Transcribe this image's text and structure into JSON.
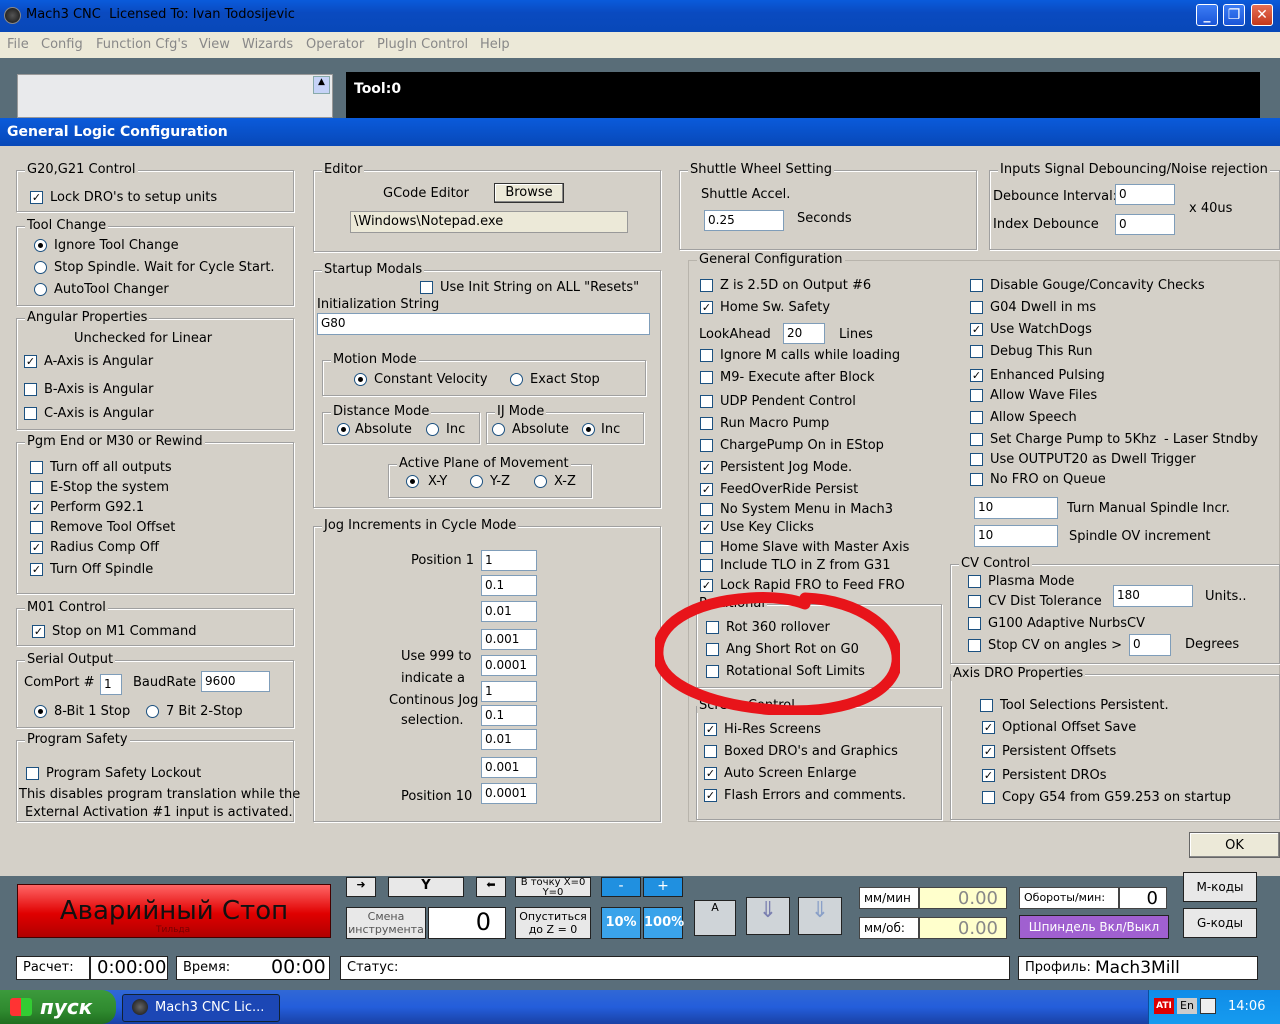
{
  "window": {
    "title": "Mach3 CNC  Licensed To: Ivan Todosijevic",
    "min": "_",
    "max": "❐",
    "close": "✕"
  },
  "menu": [
    "File",
    "Config",
    "Function Cfg's",
    "View",
    "Wizards",
    "Operator",
    "PlugIn Control",
    "Help"
  ],
  "tool_display": "Tool:0",
  "dialog": {
    "title": "General Logic Configuration",
    "g20g21": {
      "title": "G20,G21 Control",
      "lock_dro": {
        "label": "Lock DRO's to setup units",
        "checked": true
      }
    },
    "tool_change": {
      "title": "Tool Change",
      "options": [
        "Ignore Tool Change",
        "Stop Spindle. Wait for Cycle Start.",
        "AutoTool Changer"
      ],
      "selected": 0
    },
    "angular": {
      "title": "Angular Properties",
      "note": "Unchecked for Linear",
      "a": "A-Axis is Angular",
      "b": "B-Axis is Angular",
      "c": "C-Axis is Angular"
    },
    "pgm_end": {
      "title": "Pgm End or M30 or Rewind",
      "items": [
        "Turn off all outputs",
        "E-Stop the system",
        "Perform G92.1",
        "Remove Tool Offset",
        "Radius Comp Off",
        "Turn Off Spindle"
      ]
    },
    "m01": {
      "title": "M01 Control",
      "label": "Stop on M1 Command"
    },
    "serial": {
      "title": "Serial Output",
      "comport_label": "ComPort #",
      "comport": "1",
      "baud_label": "BaudRate",
      "baud": "9600",
      "bit8": "8-Bit 1 Stop",
      "bit7": "7 Bit 2-Stop"
    },
    "safety": {
      "title": "Program Safety",
      "label": "Program Safety Lockout",
      "note1": "This disables program translation while the",
      "note2": "External Activation #1 input is activated."
    },
    "editor": {
      "title": "Editor",
      "label": "GCode Editor",
      "browse": "Browse",
      "path": "\\Windows\\Notepad.exe"
    },
    "startup": {
      "title": "Startup Modals",
      "use_init": "Use Init String on ALL  \"Resets\"",
      "init_label": "Initialization String",
      "init_value": "G80"
    },
    "motion": {
      "title": "Motion Mode",
      "cv": "Constant Velocity",
      "es": "Exact Stop"
    },
    "distance": {
      "title": "Distance Mode",
      "abs": "Absolute",
      "inc": "Inc"
    },
    "ij": {
      "title": "IJ Mode",
      "abs": "Absolute",
      "inc": "Inc"
    },
    "plane": {
      "title": "Active Plane of Movement",
      "xy": "X-Y",
      "yz": "Y-Z",
      "xz": "X-Z"
    },
    "jog": {
      "title": "Jog Increments in Cycle Mode",
      "pos1": "Position 1",
      "pos10": "Position 10",
      "note": [
        "Use 999 to",
        "indicate a",
        "Continous Jog",
        "selection."
      ],
      "values": [
        "1",
        "0.1",
        "0.01",
        "0.001",
        "0.0001",
        "1",
        "0.1",
        "0.01",
        "0.001",
        "0.0001"
      ]
    },
    "shuttle": {
      "title": "Shuttle Wheel Setting",
      "label": "Shuttle Accel.",
      "value": "0.25",
      "unit": "Seconds"
    },
    "debounce": {
      "title": "Inputs Signal Debouncing/Noise rejection",
      "interval_label": "Debounce Interval:",
      "interval": "0",
      "index_label": "Index Debounce",
      "index": "0",
      "unit": "x 40us"
    },
    "general": {
      "title": "General Configuration",
      "z25d": "Z is 2.5D on Output #6",
      "home_safety": "Home Sw. Safety",
      "lookahead_label": "LookAhead",
      "lookahead": "20",
      "lines": "Lines",
      "left": [
        "Ignore M calls while loading",
        "M9- Execute after Block",
        "UDP Pendent Control",
        "Run Macro Pump",
        "ChargePump On in EStop",
        "Persistent Jog Mode.",
        "FeedOverRide Persist",
        "No System Menu in Mach3",
        "Use Key Clicks",
        "Home Slave with Master Axis",
        "Include TLO in Z from G31",
        "Lock Rapid FRO to Feed FRO"
      ],
      "right": [
        "Disable Gouge/Concavity Checks",
        "G04 Dwell in ms",
        "Use WatchDogs",
        "Debug This Run",
        "Enhanced Pulsing",
        "Allow Wave Files",
        "Allow Speech",
        "Set Charge Pump to 5Khz",
        "Use OUTPUT20 as Dwell Trigger",
        "No FRO on Queue"
      ],
      "laser": "- Laser Stndby",
      "spindle_incr_value": "10",
      "spindle_incr_label": "Turn Manual Spindle Incr.",
      "spindle_ov_value": "10",
      "spindle_ov_label": "Spindle OV increment"
    },
    "rotational": {
      "title": "Rotational",
      "items": [
        "Rot 360 rollover",
        "Ang Short Rot on G0",
        "Rotational Soft Limits"
      ]
    },
    "screen": {
      "title": "Screen Control",
      "items": [
        "Hi-Res Screens",
        "Boxed DRO's and Graphics",
        "Auto Screen Enlarge",
        "Flash Errors and comments."
      ]
    },
    "cv": {
      "title": "CV Control",
      "plasma": "Plasma Mode",
      "dist": "CV Dist Tolerance",
      "dist_value": "180",
      "units": "Units..",
      "g100": "G100 Adaptive NurbsCV",
      "angles": "Stop CV on angles >",
      "angles_value": "0",
      "degrees": "Degrees"
    },
    "axis_dro": {
      "title": "Axis DRO Properties",
      "items": [
        "Tool Selections Persistent.",
        "Optional Offset Save",
        "Persistent Offsets",
        "Persistent DROs",
        "Copy G54 from G59.253 on startup"
      ]
    },
    "ok": "OK"
  },
  "bottom": {
    "estop": "Аварийный Стоп",
    "estop_hint": "Тильда",
    "goto_zero": "В точку X=0 Y=0",
    "tool_change": "Смена инструмента",
    "tool_num": "0",
    "lower_z": "Опуститься до Z = 0",
    "pct10": "10%",
    "pct100": "100%",
    "minus": "-",
    "plus": "+",
    "y": "Y",
    "feed_label": "мм/мин",
    "feed_value": "0.00",
    "feedrev_label": "мм/об:",
    "feedrev_value": "0.00",
    "rpm_label": "Обороты/мин:",
    "rpm_value": "0",
    "spindle_btn": "Шпиндель Вкл/Выкл",
    "mcodes": "M-коды",
    "gcodes": "G-коды",
    "calc_label": "Расчет:",
    "calc_value": "0:00:00",
    "time_label": "Время:",
    "time_value": "00:00",
    "status_label": "Статус:",
    "profile_label": "Профиль:",
    "profile_value": "Mach3Mill"
  },
  "taskbar": {
    "start": "пуск",
    "task": "Mach3 CNC  Lic...",
    "lang": "En",
    "clock": "14:06"
  },
  "colors": {
    "annotation": "#e8141a",
    "title_blue": "#0a5bdb"
  }
}
